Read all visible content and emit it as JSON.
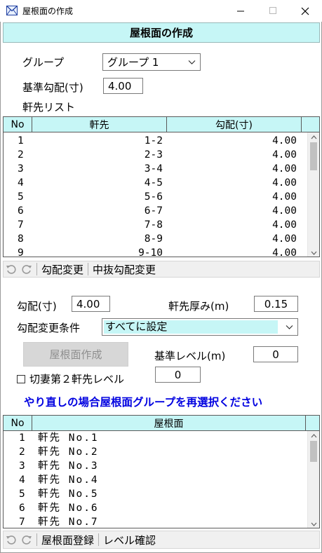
{
  "window": {
    "title": "屋根面の作成",
    "icon": "mail-envelope-icon"
  },
  "header": {
    "title": "屋根面の作成"
  },
  "group": {
    "label": "グループ",
    "selected": "グループ 1"
  },
  "base_slope": {
    "label": "基準勾配(寸)",
    "value": "4.00"
  },
  "eave_list": {
    "label": "軒先リスト",
    "columns": [
      "No",
      "軒先",
      "勾配(寸)"
    ],
    "rows": [
      {
        "no": "1",
        "eave": "1-2",
        "slope": "4.00"
      },
      {
        "no": "2",
        "eave": "2-3",
        "slope": "4.00"
      },
      {
        "no": "3",
        "eave": "3-4",
        "slope": "4.00"
      },
      {
        "no": "4",
        "eave": "4-5",
        "slope": "4.00"
      },
      {
        "no": "5",
        "eave": "5-6",
        "slope": "4.00"
      },
      {
        "no": "6",
        "eave": "6-7",
        "slope": "4.00"
      },
      {
        "no": "7",
        "eave": "7-8",
        "slope": "4.00"
      },
      {
        "no": "8",
        "eave": "8-9",
        "slope": "4.00"
      },
      {
        "no": "9",
        "eave": "9-10",
        "slope": "4.00"
      }
    ]
  },
  "toolbar1": {
    "slope_change": "勾配変更",
    "mid_slope_change": "中抜勾配変更"
  },
  "slope": {
    "label": "勾配(寸)",
    "value": "4.00"
  },
  "eave_thickness": {
    "label": "軒先厚み(m)",
    "value": "0.15"
  },
  "slope_condition": {
    "label": "勾配変更条件",
    "selected": "すべてに設定"
  },
  "create_button": {
    "label": "屋根面作成"
  },
  "base_level": {
    "label": "基準レベル(m)",
    "value": "0"
  },
  "gable_level": {
    "label": "切妻第２軒先レベル",
    "value": "0",
    "checked": false
  },
  "message": "やり直しの場合屋根面グループを再選択ください",
  "roof_list": {
    "columns": [
      "No",
      "屋根面"
    ],
    "rows": [
      {
        "no": "1",
        "name": "軒先 No.1"
      },
      {
        "no": "2",
        "name": "軒先 No.2"
      },
      {
        "no": "3",
        "name": "軒先 No.3"
      },
      {
        "no": "4",
        "name": "軒先 No.4"
      },
      {
        "no": "5",
        "name": "軒先 No.5"
      },
      {
        "no": "6",
        "name": "軒先 No.6"
      },
      {
        "no": "7",
        "name": "軒先 No.7"
      }
    ]
  },
  "toolbar2": {
    "register": "屋根面登録",
    "level_check": "レベル確認"
  },
  "colors": {
    "header_bg": "#c6f6f6",
    "combo_highlight": "#c6f6f6",
    "message": "#0000e0",
    "disabled_button": "#d7d7d7"
  }
}
